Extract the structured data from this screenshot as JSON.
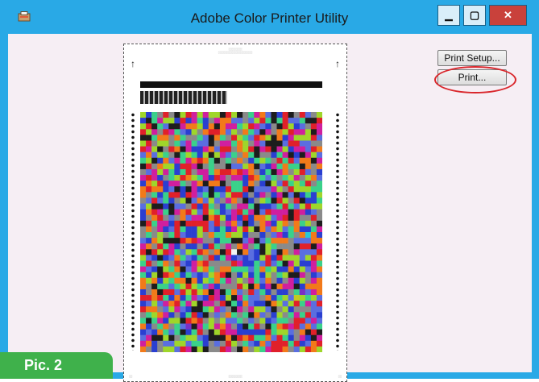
{
  "window": {
    "title": "Adobe Color Printer Utility",
    "minimize_glyph": "▁",
    "maximize_glyph": "▢",
    "close_glyph": "✕",
    "icon": "app-icon"
  },
  "buttons": {
    "print_setup_label": "Print Setup...",
    "print_label": "Print..."
  },
  "colors": {
    "title_bar": "#29a9e6",
    "client_bg": "#f6eef4",
    "close_button": "#c9413b",
    "highlight": "#d9262b",
    "badge": "#3fb14b"
  },
  "badge": {
    "label": "Pic. 2"
  },
  "target_preview": {
    "patch_palette": [
      "#e0202a",
      "#1a9e3c",
      "#2a3fd1",
      "#f1d615",
      "#d01f9e",
      "#27c7d8",
      "#f27a1a",
      "#7a2fc4",
      "#1d1d1d",
      "#f3f3f3",
      "#9fd62a",
      "#e85aa8",
      "#3ad18a",
      "#c4c91f",
      "#5a6ee0",
      "#c03a2a",
      "#8a8a8a",
      "#18b8a0"
    ]
  }
}
